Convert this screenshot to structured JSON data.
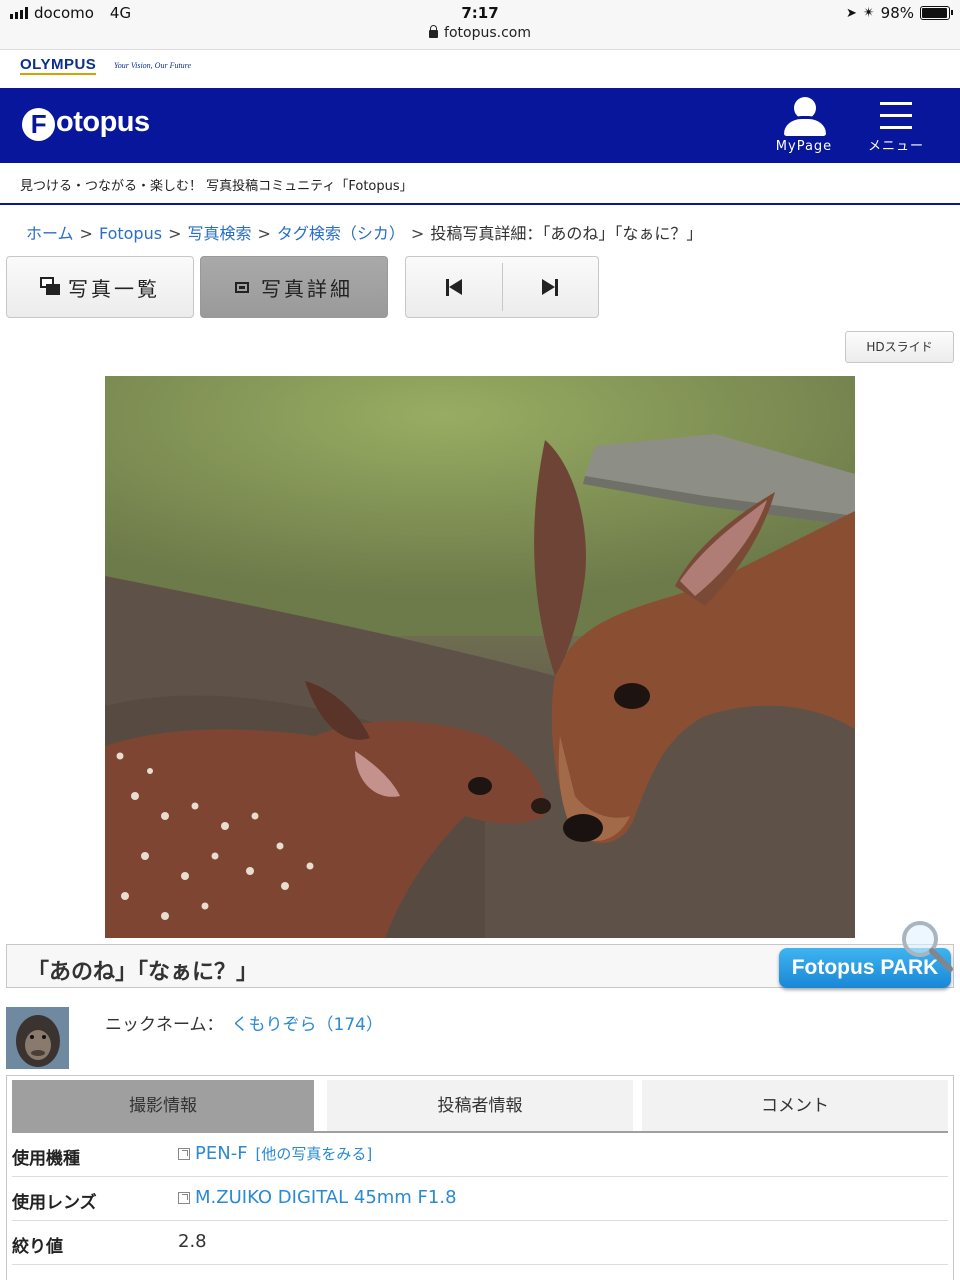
{
  "status_bar": {
    "carrier": "docomo",
    "network": "4G",
    "time": "7:17",
    "url": "fotopus.com",
    "battery": "98%",
    "battery_level": 0.98
  },
  "olympus": {
    "logo": "OLYMPUS",
    "tagline": "Your Vision, Our Future"
  },
  "header": {
    "brand": "otopus",
    "brand_initial": "F",
    "mypage_label": "MyPage",
    "menu_label": "メニュー",
    "color": "#07169a"
  },
  "tagline": "見つける・つながる・楽しむ！ 写真投稿コミュニティ「Fotopus」",
  "breadcrumb": {
    "home": "ホーム",
    "fotopus": "Fotopus",
    "search": "写真検索",
    "tag": "タグ検索（シカ）",
    "current": "投稿写真詳細：「あのね」「なぁに？」",
    "sep": ">"
  },
  "buttons": {
    "photo_list": "写真一覧",
    "photo_detail": "写真詳細",
    "hd_slide": "HDスライド"
  },
  "photo": {
    "title": "「あのね」「なぁに？」"
  },
  "park_button": "Fotopus PARK",
  "user": {
    "nickname_label": "ニックネーム：",
    "nickname": "くもりぞら（174）"
  },
  "info_tabs": [
    {
      "label": "撮影情報",
      "active": true
    },
    {
      "label": "投稿者情報",
      "active": false
    },
    {
      "label": "コメント",
      "active": false
    }
  ],
  "shooting_info": [
    {
      "key": "使用機種",
      "value": "PEN-F",
      "extra": "[他の写真をみる]"
    },
    {
      "key": "使用レンズ",
      "value": "M.ZUIKO DIGITAL 45mm F1.8"
    },
    {
      "key": "絞り値",
      "value": "2.8"
    }
  ]
}
